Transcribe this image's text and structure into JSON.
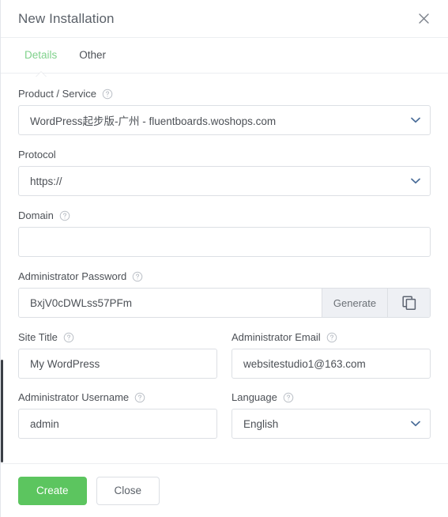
{
  "header": {
    "title": "New Installation",
    "close_icon": "close-icon"
  },
  "tabs": [
    {
      "label": "Details",
      "active": true
    },
    {
      "label": "Other",
      "active": false
    }
  ],
  "form": {
    "product_service": {
      "label": "Product / Service",
      "help": true,
      "value": "WordPress起步版-广州 - fluentboards.woshops.com",
      "type": "select"
    },
    "protocol": {
      "label": "Protocol",
      "help": false,
      "value": "https://",
      "type": "select"
    },
    "domain": {
      "label": "Domain",
      "help": true,
      "value": "",
      "placeholder": "",
      "type": "text"
    },
    "administrator_password": {
      "label": "Administrator Password",
      "help": true,
      "value": "BxjV0cDWLss57PFm",
      "generate_label": "Generate",
      "copy_icon": "copy-icon",
      "type": "text"
    },
    "site_title": {
      "label": "Site Title",
      "help": true,
      "value": "My WordPress",
      "type": "text"
    },
    "administrator_email": {
      "label": "Administrator Email",
      "help": true,
      "value": "websitestudio1@163.com",
      "type": "text"
    },
    "administrator_username": {
      "label": "Administrator Username",
      "help": true,
      "value": "admin",
      "type": "text"
    },
    "language": {
      "label": "Language",
      "help": true,
      "value": "English",
      "type": "select"
    }
  },
  "footer": {
    "create_label": "Create",
    "close_label": "Close"
  },
  "colors": {
    "accent_green": "#5cc55f",
    "tab_active": "#7fd18b",
    "chevron_blue": "#4a6d99",
    "border": "#dcdfe4",
    "text": "#4c5056"
  }
}
